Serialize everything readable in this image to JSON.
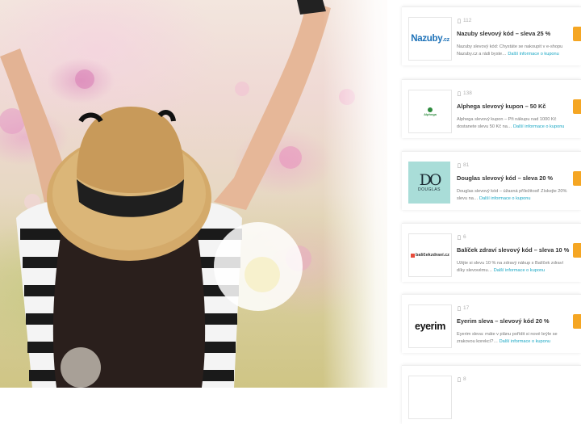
{
  "coupons": [
    {
      "logo_text": "Nazuby",
      "logo_suffix": ".cz",
      "views": "112",
      "title": "Nazuby slevový kód – sleva 25 %",
      "desc": "Nazuby slevový kód: Chystáte se nakoupit v e-shopu Nazuby.cz a rádi byste…",
      "more": "Další informace o kuponu"
    },
    {
      "logo_text": "Alphega",
      "logo_sub": "",
      "views": "138",
      "title": "Alphega slevový kupon – 50 Kč",
      "desc": "Alphega slevový kupon – Při nákupu nad 1000 Kč dostanete slevu 50 Kč na…",
      "more": "Další informace o kuponu"
    },
    {
      "logo_text": "DO",
      "logo_sub": "DOUGLAS",
      "views": "81",
      "title": "Douglas slevový kód – sleva 20 %",
      "desc": "Douglas slevový kód – úžasná příležitost! Získejte 20% slevu na…",
      "more": "Další informace o kuponu"
    },
    {
      "logo_text": "balíčekzdraví.cz",
      "logo_sub": "",
      "views": "6",
      "title": "Balíček zdraví slevový kód – sleva 10 %",
      "desc": "Užijte si slevu 10 % na zdravý nákup s Balíček zdraví díky slevovému…",
      "more": "Další informace o kuponu"
    },
    {
      "logo_text": "eyerim",
      "views": "17",
      "title": "Eyerim sleva – slevový kód 20 %",
      "desc": "Eyerim sleva: máte v plánu pořídit si nové brýle se zrakovou korekcí?…",
      "more": "Další informace o kuponu"
    },
    {
      "logo_text": "",
      "views": "8",
      "title": "",
      "desc": "",
      "more": ""
    }
  ],
  "icons": {
    "views": "eye-icon"
  },
  "colors": {
    "accent": "#f5a623",
    "link": "#1aa7c4"
  }
}
